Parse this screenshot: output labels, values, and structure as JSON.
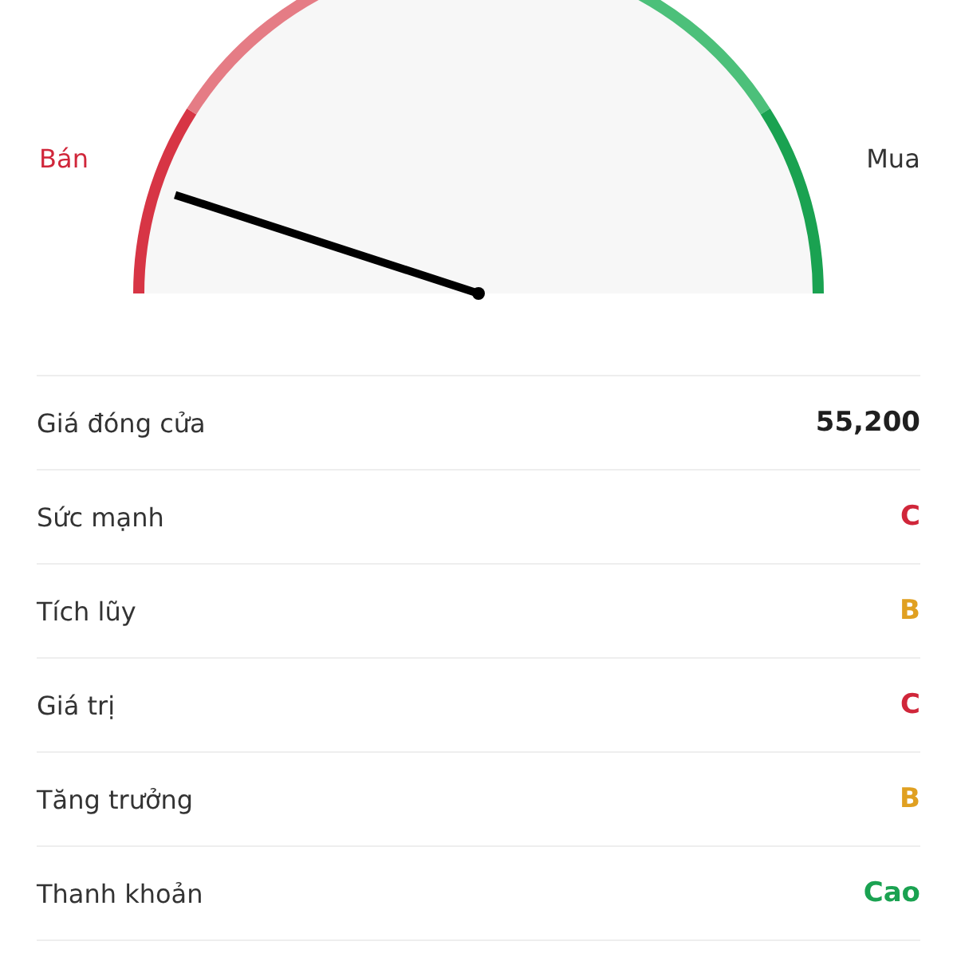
{
  "gauge": {
    "left_label": "Bán",
    "right_label": "Mua",
    "level": 0.1
  },
  "rows": [
    {
      "label": "Giá đóng cửa",
      "value": "55,200",
      "color": "#1f1f1f"
    },
    {
      "label": "Sức mạnh",
      "value": "C",
      "color": "#d0263a"
    },
    {
      "label": "Tích lũy",
      "value": "B",
      "color": "#e0a021"
    },
    {
      "label": "Giá trị",
      "value": "C",
      "color": "#d0263a"
    },
    {
      "label": "Tăng trưởng",
      "value": "B",
      "color": "#e0a021"
    },
    {
      "label": "Thanh khoản",
      "value": "Cao",
      "color": "#1aa251"
    }
  ]
}
